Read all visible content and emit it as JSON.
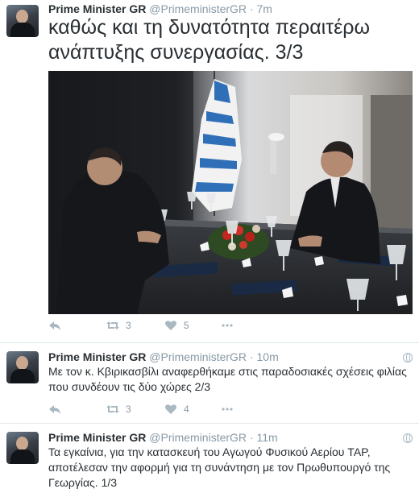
{
  "colors": {
    "name": "#292f33",
    "muted": "#8899a6",
    "icon": "#aab8c2",
    "divider": "#e1e8ed"
  },
  "tweets": [
    {
      "name": "Prime Minister GR",
      "handle": "@PrimeministerGR",
      "separator": "·",
      "time": "7m",
      "text_lines": [
        "καθώς και τη δυνατότητα περαιτέρω",
        "ανάπτυξης συνεργασίας. 3/3"
      ],
      "retweets": "3",
      "likes": "5"
    },
    {
      "name": "Prime Minister GR",
      "handle": "@PrimeministerGR",
      "separator": "·",
      "time": "10m",
      "text_lines": [
        "Με τον κ. Κβιρικασβίλι αναφερθήκαμε στις παραδοσιακές σχέσεις φιλίας",
        "που συνδέουν τις δύο χώρες 2/3"
      ],
      "retweets": "3",
      "likes": "4"
    },
    {
      "name": "Prime Minister GR",
      "handle": "@PrimeministerGR",
      "separator": "·",
      "time": "11m",
      "text_lines": [
        "Τα εγκαίνια, για την κατασκευή του Αγωγού Φυσικού Αερίου TAP,",
        "αποτέλεσαν την αφορμή για τη συνάντηση με τον Πρωθυπουργό της",
        "Γεωργίας. 1/3"
      ]
    }
  ]
}
